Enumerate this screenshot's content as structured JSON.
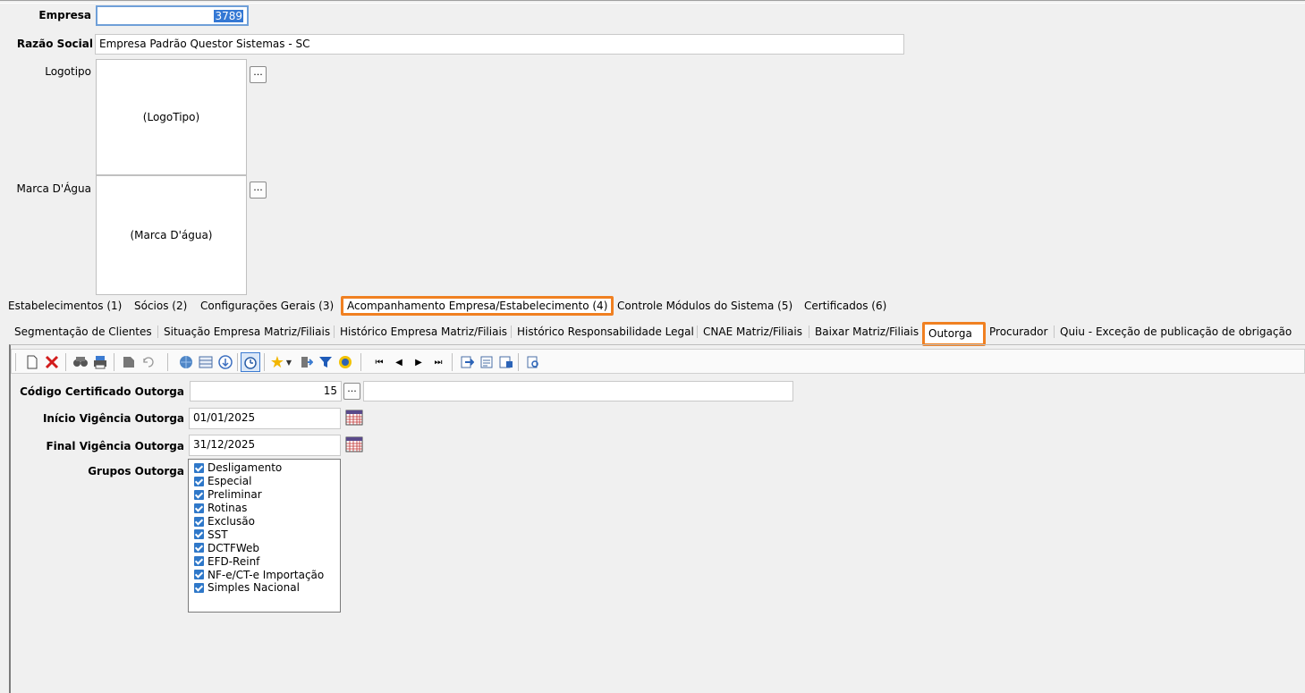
{
  "form": {
    "empresa_label": "Empresa",
    "empresa_value": "3789",
    "razao_label": "Razão Social",
    "razao_value": "Empresa Padrão Questor Sistemas - SC",
    "logotipo_label": "Logotipo",
    "logotipo_placeholder": "(LogoTipo)",
    "marca_label": "Marca D'Água",
    "marca_placeholder": "(Marca D'água)",
    "browse_label": "..."
  },
  "main_tabs": [
    {
      "label": "Estabelecimentos (1)"
    },
    {
      "label": "Sócios (2)"
    },
    {
      "label": "Configurações Gerais (3)"
    },
    {
      "label": "Acompanhamento Empresa/Estabelecimento (4)",
      "active": true
    },
    {
      "label": "Controle Módulos do Sistema (5)"
    },
    {
      "label": "Certificados (6)"
    }
  ],
  "sub_tabs": [
    {
      "label": "Segmentação de Clientes"
    },
    {
      "label": "Situação Empresa Matriz/Filiais"
    },
    {
      "label": "Histórico Empresa Matriz/Filiais"
    },
    {
      "label": "Histórico Responsabilidade Legal"
    },
    {
      "label": "CNAE Matriz/Filiais"
    },
    {
      "label": "Baixar Matriz/Filiais"
    },
    {
      "label": "Outorga",
      "active": true
    },
    {
      "label": "Procurador"
    },
    {
      "label": "Quiu - Exceção de publicação de obrigação"
    }
  ],
  "toolbar_icons": [
    "new-icon",
    "delete-icon",
    "search-icon",
    "print-icon",
    "save-icon",
    "refresh-icon",
    "globe-icon",
    "grid-icon",
    "info-icon",
    "clock-icon",
    "star-icon",
    "dropdown-icon",
    "exit-icon",
    "filter-icon",
    "help-icon",
    "first-icon",
    "prev-icon",
    "next-icon",
    "last-icon",
    "export-icon",
    "report-icon",
    "report2-icon",
    "preview-icon"
  ],
  "outorga": {
    "codigo_label": "Código Certificado Outorga",
    "codigo_value": "15",
    "inicio_label": "Início Vigência Outorga",
    "inicio_value": "01/01/2025",
    "final_label": "Final Vigência Outorga",
    "final_value": "31/12/2025",
    "grupos_label": "Grupos Outorga",
    "grupos": [
      {
        "label": "Desligamento",
        "checked": true
      },
      {
        "label": "Especial",
        "checked": true
      },
      {
        "label": "Preliminar",
        "checked": true
      },
      {
        "label": "Rotinas",
        "checked": true
      },
      {
        "label": "Exclusão",
        "checked": true
      },
      {
        "label": "SST",
        "checked": true
      },
      {
        "label": "DCTFWeb",
        "checked": true
      },
      {
        "label": "EFD-Reinf",
        "checked": true
      },
      {
        "label": "NF-e/CT-e Importação",
        "checked": true
      },
      {
        "label": "Simples Nacional",
        "checked": true
      }
    ]
  },
  "colors": {
    "highlight": "#f08021",
    "selection": "#3478d4",
    "checkbox": "#2f78c9"
  }
}
